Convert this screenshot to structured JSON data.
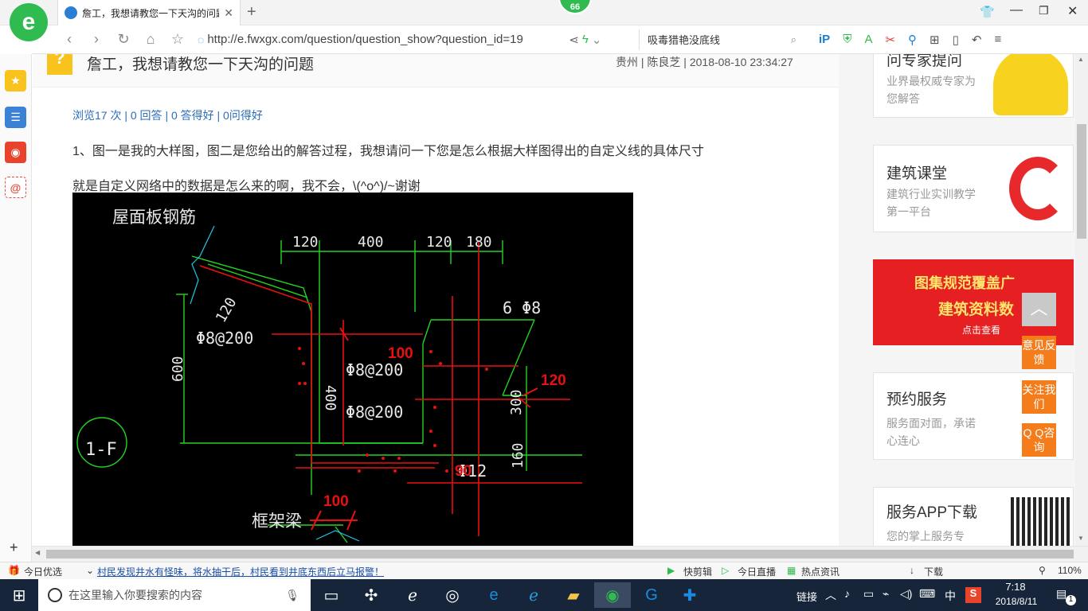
{
  "browser": {
    "tab_title": "詹工，我想请教您一下天沟的问题",
    "badge_count": "66",
    "url": "http://e.fwxgx.com/question/question_show?question_id=19",
    "search_text": "吸毒猎艳没底线"
  },
  "question": {
    "title": "詹工，我想请教您一下天沟的问题",
    "meta": "贵州 | 陈良芝 | 2018-08-10 23:34:27",
    "stats": "浏览17 次 | 0 回答 | 0 答得好 | 0问得好",
    "para1": "1、图一是我的大样图，图二是您给出的解答过程，我想请问一下您是怎么根据大样图得出的自定义线的具体尺寸",
    "para2": "就是自定义网络中的数据是怎么来的啊，我不会，\\(^o^)/~谢谢"
  },
  "drawing": {
    "label_roof": "屋面板钢筋",
    "label_beam": "框架梁",
    "label_section": "1-F",
    "dims": [
      "120",
      "400",
      "120",
      "180",
      "120",
      "600",
      "400",
      "300",
      "160"
    ],
    "rebar": [
      "Φ8@200",
      "Φ8@200",
      "Φ8@200",
      "6 Φ8",
      "Φ12"
    ],
    "red_labels": [
      "100",
      "120",
      "100",
      "90"
    ]
  },
  "sidebar": {
    "card1_title": "问专家提问",
    "card1_desc": "业界最权威专家为您解答",
    "card2_title": "建筑课堂",
    "card2_desc": "建筑行业实训教学第一平台",
    "banner_line1": "图集规范覆盖广",
    "banner_line2": "建筑资料数",
    "banner_btn": "点击查看",
    "card3_title": "预约服务",
    "card3_desc": "服务面对面，承诺心连心",
    "card4_title": "服务APP下载",
    "card4_desc": "您的掌上服务专"
  },
  "float_buttons": {
    "feedback": "意见反馈",
    "follow": "关注我们",
    "qq": "Q Q咨询"
  },
  "statusbar": {
    "today_pick": "今日优选",
    "news": "村民发现井水有怪味，将水抽干后，村民看到井底东西后立马报警！",
    "quick_clip": "快剪辑",
    "live": "今日直播",
    "hot": "热点资讯",
    "download": "下载",
    "zoom": "110%"
  },
  "taskbar": {
    "search_placeholder": "在这里输入你要搜索的内容",
    "link_label": "链接",
    "ime": "中",
    "time": "7:18",
    "date": "2018/8/11",
    "notif": "1"
  },
  "colors": {
    "accent_green": "#2fbb4f",
    "link_blue": "#2a6ebb",
    "float_orange": "#f57c1b",
    "cad_red": "#e81010",
    "cad_green": "#22d422"
  }
}
